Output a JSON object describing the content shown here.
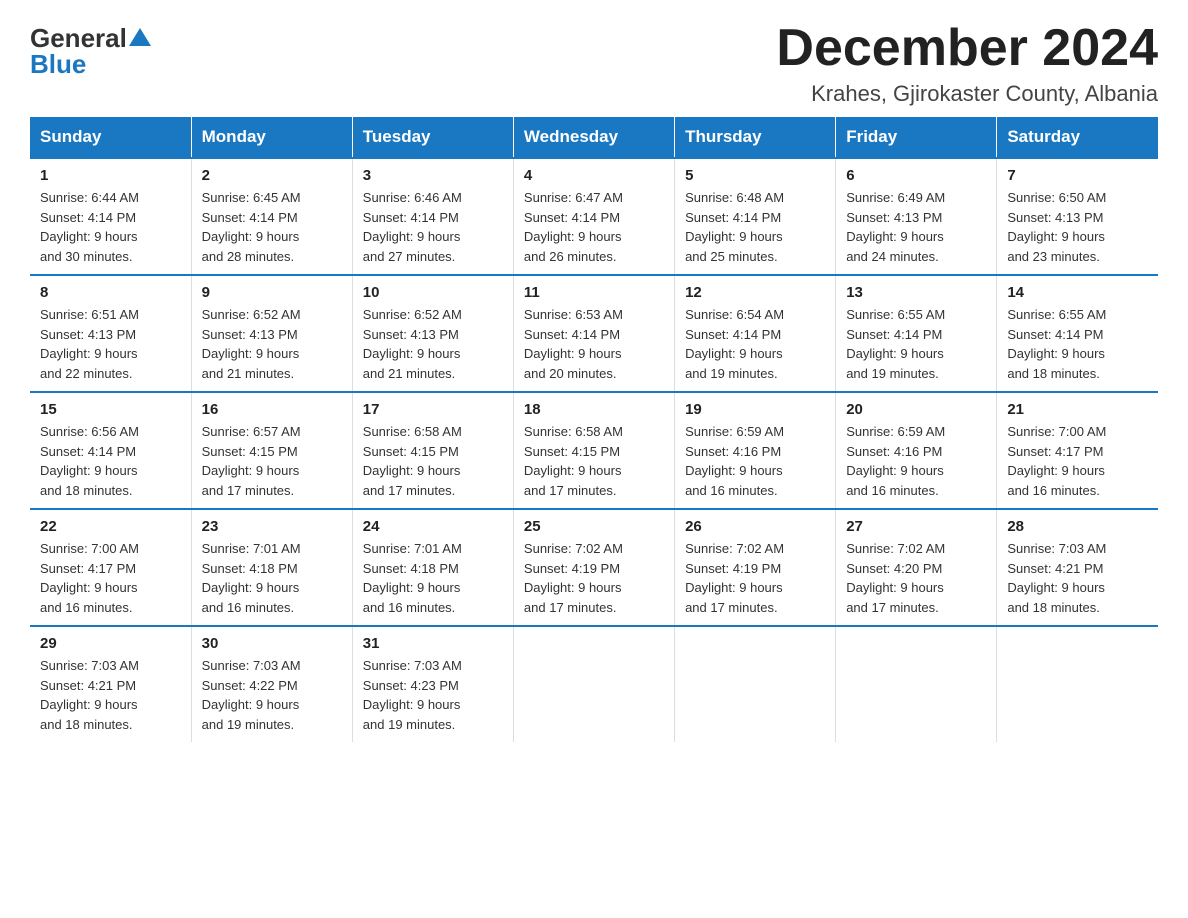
{
  "logo": {
    "general": "General",
    "blue": "Blue"
  },
  "title": "December 2024",
  "subtitle": "Krahes, Gjirokaster County, Albania",
  "days_of_week": [
    "Sunday",
    "Monday",
    "Tuesday",
    "Wednesday",
    "Thursday",
    "Friday",
    "Saturday"
  ],
  "weeks": [
    [
      {
        "day": "1",
        "sunrise": "6:44 AM",
        "sunset": "4:14 PM",
        "daylight": "9 hours and 30 minutes."
      },
      {
        "day": "2",
        "sunrise": "6:45 AM",
        "sunset": "4:14 PM",
        "daylight": "9 hours and 28 minutes."
      },
      {
        "day": "3",
        "sunrise": "6:46 AM",
        "sunset": "4:14 PM",
        "daylight": "9 hours and 27 minutes."
      },
      {
        "day": "4",
        "sunrise": "6:47 AM",
        "sunset": "4:14 PM",
        "daylight": "9 hours and 26 minutes."
      },
      {
        "day": "5",
        "sunrise": "6:48 AM",
        "sunset": "4:14 PM",
        "daylight": "9 hours and 25 minutes."
      },
      {
        "day": "6",
        "sunrise": "6:49 AM",
        "sunset": "4:13 PM",
        "daylight": "9 hours and 24 minutes."
      },
      {
        "day": "7",
        "sunrise": "6:50 AM",
        "sunset": "4:13 PM",
        "daylight": "9 hours and 23 minutes."
      }
    ],
    [
      {
        "day": "8",
        "sunrise": "6:51 AM",
        "sunset": "4:13 PM",
        "daylight": "9 hours and 22 minutes."
      },
      {
        "day": "9",
        "sunrise": "6:52 AM",
        "sunset": "4:13 PM",
        "daylight": "9 hours and 21 minutes."
      },
      {
        "day": "10",
        "sunrise": "6:52 AM",
        "sunset": "4:13 PM",
        "daylight": "9 hours and 21 minutes."
      },
      {
        "day": "11",
        "sunrise": "6:53 AM",
        "sunset": "4:14 PM",
        "daylight": "9 hours and 20 minutes."
      },
      {
        "day": "12",
        "sunrise": "6:54 AM",
        "sunset": "4:14 PM",
        "daylight": "9 hours and 19 minutes."
      },
      {
        "day": "13",
        "sunrise": "6:55 AM",
        "sunset": "4:14 PM",
        "daylight": "9 hours and 19 minutes."
      },
      {
        "day": "14",
        "sunrise": "6:55 AM",
        "sunset": "4:14 PM",
        "daylight": "9 hours and 18 minutes."
      }
    ],
    [
      {
        "day": "15",
        "sunrise": "6:56 AM",
        "sunset": "4:14 PM",
        "daylight": "9 hours and 18 minutes."
      },
      {
        "day": "16",
        "sunrise": "6:57 AM",
        "sunset": "4:15 PM",
        "daylight": "9 hours and 17 minutes."
      },
      {
        "day": "17",
        "sunrise": "6:58 AM",
        "sunset": "4:15 PM",
        "daylight": "9 hours and 17 minutes."
      },
      {
        "day": "18",
        "sunrise": "6:58 AM",
        "sunset": "4:15 PM",
        "daylight": "9 hours and 17 minutes."
      },
      {
        "day": "19",
        "sunrise": "6:59 AM",
        "sunset": "4:16 PM",
        "daylight": "9 hours and 16 minutes."
      },
      {
        "day": "20",
        "sunrise": "6:59 AM",
        "sunset": "4:16 PM",
        "daylight": "9 hours and 16 minutes."
      },
      {
        "day": "21",
        "sunrise": "7:00 AM",
        "sunset": "4:17 PM",
        "daylight": "9 hours and 16 minutes."
      }
    ],
    [
      {
        "day": "22",
        "sunrise": "7:00 AM",
        "sunset": "4:17 PM",
        "daylight": "9 hours and 16 minutes."
      },
      {
        "day": "23",
        "sunrise": "7:01 AM",
        "sunset": "4:18 PM",
        "daylight": "9 hours and 16 minutes."
      },
      {
        "day": "24",
        "sunrise": "7:01 AM",
        "sunset": "4:18 PM",
        "daylight": "9 hours and 16 minutes."
      },
      {
        "day": "25",
        "sunrise": "7:02 AM",
        "sunset": "4:19 PM",
        "daylight": "9 hours and 17 minutes."
      },
      {
        "day": "26",
        "sunrise": "7:02 AM",
        "sunset": "4:19 PM",
        "daylight": "9 hours and 17 minutes."
      },
      {
        "day": "27",
        "sunrise": "7:02 AM",
        "sunset": "4:20 PM",
        "daylight": "9 hours and 17 minutes."
      },
      {
        "day": "28",
        "sunrise": "7:03 AM",
        "sunset": "4:21 PM",
        "daylight": "9 hours and 18 minutes."
      }
    ],
    [
      {
        "day": "29",
        "sunrise": "7:03 AM",
        "sunset": "4:21 PM",
        "daylight": "9 hours and 18 minutes."
      },
      {
        "day": "30",
        "sunrise": "7:03 AM",
        "sunset": "4:22 PM",
        "daylight": "9 hours and 19 minutes."
      },
      {
        "day": "31",
        "sunrise": "7:03 AM",
        "sunset": "4:23 PM",
        "daylight": "9 hours and 19 minutes."
      },
      null,
      null,
      null,
      null
    ]
  ]
}
